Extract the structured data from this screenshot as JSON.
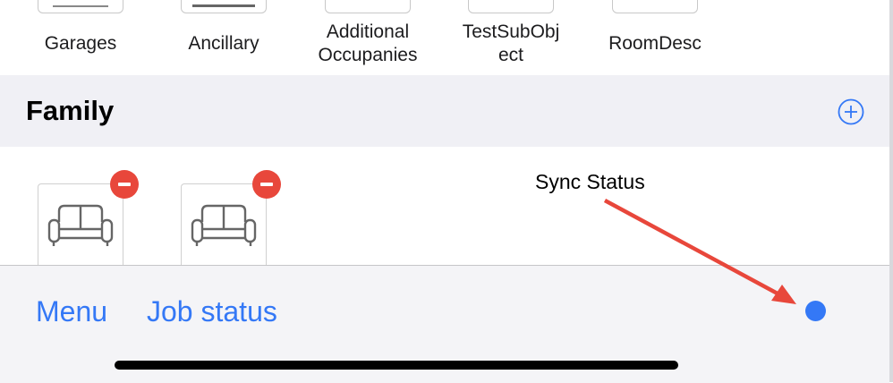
{
  "top_items": [
    {
      "line1": "Garages",
      "line2": ""
    },
    {
      "line1": "Ancillary",
      "line2": ""
    },
    {
      "line1": "Additional",
      "line2": "Occupanies"
    },
    {
      "line1": "TestSubObj",
      "line2": "ect"
    },
    {
      "line1": "RoomDesc",
      "line2": ""
    }
  ],
  "section": {
    "title": "Family",
    "add_icon": "plus-circle-icon"
  },
  "items": [
    {
      "icon": "sofa-icon",
      "badge": "remove-badge-icon"
    },
    {
      "icon": "sofa-icon",
      "badge": "remove-badge-icon"
    }
  ],
  "annotation": {
    "text": "Sync Status",
    "color": "#e8473b"
  },
  "toolbar": {
    "menu_label": "Menu",
    "job_status_label": "Job status",
    "sync_status_color": "#3478f6"
  },
  "colors": {
    "accent": "#3478f6",
    "destructive": "#e8473b",
    "section_bg": "#f0f0f5"
  }
}
